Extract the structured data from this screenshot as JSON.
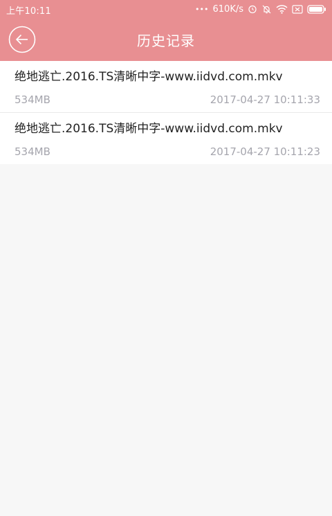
{
  "status_bar": {
    "time": "上午10:11",
    "dots": "•••",
    "network_speed": "610K/s",
    "icons": [
      "alarm-icon",
      "mute-bell-icon",
      "wifi-icon",
      "sim-off-icon",
      "battery-icon"
    ]
  },
  "header": {
    "title": "历史记录",
    "back_icon": "back-arrow-icon"
  },
  "colors": {
    "accent": "#e88f92",
    "header_text": "#ffffff",
    "primary_text": "#222222",
    "secondary_text": "#a5a5ad",
    "background": "#f7f7f7"
  },
  "history": {
    "items": [
      {
        "name": "绝地逃亡.2016.TS清晰中字-www.iidvd.com.mkv",
        "size": "534MB",
        "time": "2017-04-27 10:11:33"
      },
      {
        "name": "绝地逃亡.2016.TS清晰中字-www.iidvd.com.mkv",
        "size": "534MB",
        "time": "2017-04-27 10:11:23"
      }
    ]
  }
}
